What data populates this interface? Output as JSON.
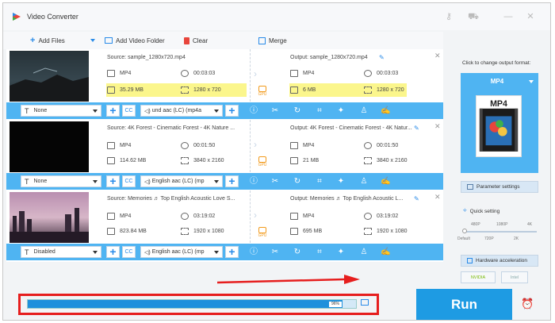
{
  "app": {
    "title": "Video Converter"
  },
  "toolbar": {
    "add_files": "Add Files",
    "add_video_folder": "Add Video Folder",
    "clear": "Clear",
    "merge": "Merge"
  },
  "files": [
    {
      "source": "Source: sample_1280x720.mp4",
      "output": "Output: sample_1280x720.mp4",
      "src_format": "MP4",
      "src_duration": "00:03:03",
      "src_size": "35.29 MB",
      "src_resolution": "1280 x 720",
      "out_format": "MP4",
      "out_duration": "00:03:03",
      "out_size": "6 MB",
      "out_resolution": "1280 x 720",
      "subtitle": "None",
      "audio": "und aac (LC) (mp4a",
      "gpu": "GPU"
    },
    {
      "source": "Source: 4K Forest - Cinematic Forest - 4K Nature ...",
      "output": "Output: 4K Forest - Cinematic Forest - 4K Natur...",
      "src_format": "MP4",
      "src_duration": "00:01:50",
      "src_size": "114.62 MB",
      "src_resolution": "3840 x 2160",
      "out_format": "MP4",
      "out_duration": "00:01:50",
      "out_size": "21 MB",
      "out_resolution": "3840 x 2160",
      "subtitle": "None",
      "audio": "English aac (LC) (mp",
      "gpu": "GPU"
    },
    {
      "source": "Source: Memories ♬ Top English Acoustic Love S...",
      "output": "Output: Memories ♬ Top English Acoustic L...",
      "src_format": "MP4",
      "src_duration": "03:19:02",
      "src_size": "823.84 MB",
      "src_resolution": "1920 x 1080",
      "out_format": "MP4",
      "out_duration": "03:19:02",
      "out_size": "695 MB",
      "out_resolution": "1920 x 1080",
      "subtitle": "Disabled",
      "audio": "English aac (LC) (mp",
      "gpu": "GPU"
    }
  ],
  "cc_label": "CC",
  "right_panel": {
    "hint": "Click to change output format:",
    "format": "MP4",
    "format_icon_text": "MP4",
    "parameter_settings": "Parameter settings",
    "quick_setting": "Quick setting",
    "quality_top": [
      "480P",
      "1080P",
      "4K"
    ],
    "quality_bottom": [
      "Default",
      "720P",
      "2K"
    ],
    "hardware_acceleration": "Hardware acceleration",
    "nvidia": "NVIDIA",
    "intel": "Intel"
  },
  "progress": {
    "percent": 0.96,
    "text": "96%"
  },
  "run_label": "Run"
}
